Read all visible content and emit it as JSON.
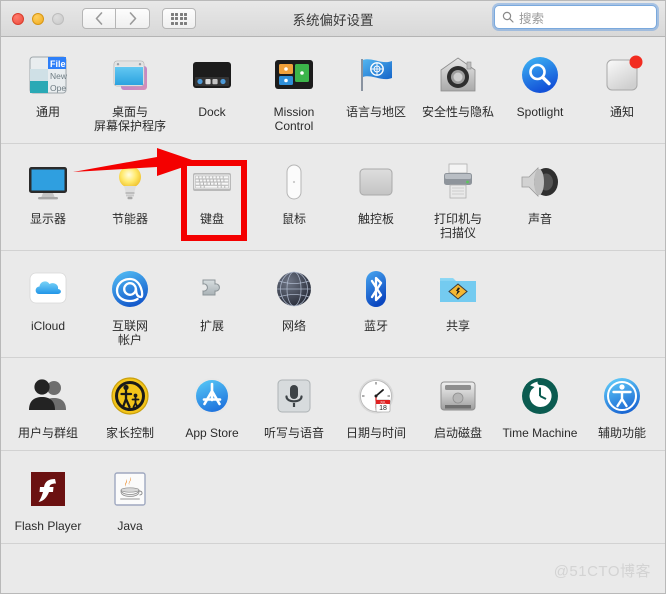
{
  "window": {
    "title": "系统偏好设置",
    "traffic_lights": [
      {
        "name": "close",
        "color": "#ec4c3c"
      },
      {
        "name": "minimize",
        "color": "#f0ab21"
      },
      {
        "name": "zoom",
        "color": "#c8c8c8"
      }
    ],
    "nav": {
      "back": "‹",
      "forward": "›"
    },
    "grid_button": "show-all-grid"
  },
  "search": {
    "placeholder": "搜索",
    "value": "",
    "icon": "search-icon",
    "focused": true
  },
  "rows": [
    {
      "name": "personal",
      "items": [
        {
          "id": "general",
          "label": "通用",
          "icon": "general-icon"
        },
        {
          "id": "desktop-saver",
          "label": "桌面与\n屏幕保护程序",
          "icon": "desktop-screensaver-icon"
        },
        {
          "id": "dock",
          "label": "Dock",
          "icon": "dock-icon"
        },
        {
          "id": "mission-control",
          "label": "Mission\nControl",
          "icon": "mission-control-icon"
        },
        {
          "id": "language-region",
          "label": "语言与地区",
          "icon": "flag-icon"
        },
        {
          "id": "security",
          "label": "安全性与隐私",
          "icon": "security-house-icon"
        },
        {
          "id": "spotlight",
          "label": "Spotlight",
          "icon": "spotlight-icon"
        },
        {
          "id": "notifications",
          "label": "通知",
          "icon": "notifications-icon"
        }
      ]
    },
    {
      "name": "hardware",
      "items": [
        {
          "id": "displays",
          "label": "显示器",
          "icon": "display-icon"
        },
        {
          "id": "energy-saver",
          "label": "节能器",
          "icon": "lightbulb-icon"
        },
        {
          "id": "keyboard",
          "label": "键盘",
          "icon": "keyboard-icon",
          "highlighted": true
        },
        {
          "id": "mouse",
          "label": "鼠标",
          "icon": "mouse-icon"
        },
        {
          "id": "trackpad",
          "label": "触控板",
          "icon": "trackpad-icon"
        },
        {
          "id": "printers",
          "label": "打印机与\n扫描仪",
          "icon": "printer-icon"
        },
        {
          "id": "sound",
          "label": "声音",
          "icon": "speaker-icon"
        }
      ]
    },
    {
      "name": "internet-wireless",
      "items": [
        {
          "id": "icloud",
          "label": "iCloud",
          "icon": "icloud-icon"
        },
        {
          "id": "internet-accounts",
          "label": "互联网\n帐户",
          "icon": "at-sign-icon"
        },
        {
          "id": "extensions",
          "label": "扩展",
          "icon": "puzzle-piece-icon"
        },
        {
          "id": "network",
          "label": "网络",
          "icon": "globe-icon"
        },
        {
          "id": "bluetooth",
          "label": "蓝牙",
          "icon": "bluetooth-icon"
        },
        {
          "id": "sharing",
          "label": "共享",
          "icon": "sharing-folder-icon"
        }
      ]
    },
    {
      "name": "system",
      "items": [
        {
          "id": "users-groups",
          "label": "用户与群组",
          "icon": "users-icon"
        },
        {
          "id": "parental-controls",
          "label": "家长控制",
          "icon": "parental-controls-icon"
        },
        {
          "id": "app-store",
          "label": "App Store",
          "icon": "app-store-icon"
        },
        {
          "id": "dictation-speech",
          "label": "听写与语音",
          "icon": "microphone-icon"
        },
        {
          "id": "date-time",
          "label": "日期与时间",
          "icon": "clock-icon"
        },
        {
          "id": "startup-disk",
          "label": "启动磁盘",
          "icon": "hard-drive-icon"
        },
        {
          "id": "time-machine",
          "label": "Time Machine",
          "icon": "time-machine-icon"
        },
        {
          "id": "accessibility",
          "label": "辅助功能",
          "icon": "accessibility-icon"
        }
      ]
    },
    {
      "name": "other",
      "items": [
        {
          "id": "flash-player",
          "label": "Flash Player",
          "icon": "flash-player-icon"
        },
        {
          "id": "java",
          "label": "Java",
          "icon": "java-icon"
        }
      ]
    }
  ],
  "annotations": {
    "highlight_color": "#f40000",
    "highlight_target": "键盘",
    "arrow": "points-right-to-keyboard"
  },
  "watermark": "@51CTO博客"
}
